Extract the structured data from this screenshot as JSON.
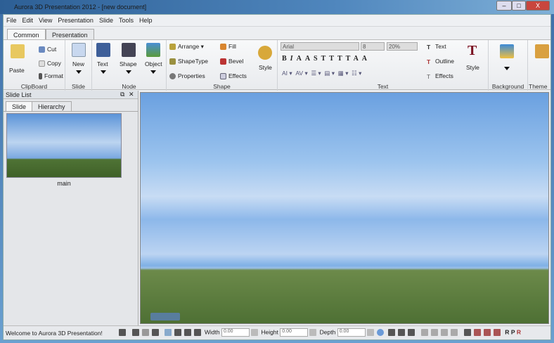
{
  "window": {
    "title": "Aurora 3D Presentation 2012 - [new document]",
    "min": "–",
    "max": "□",
    "close": "X"
  },
  "menu": [
    "File",
    "Edit",
    "View",
    "Presentation",
    "Slide",
    "Tools",
    "Help"
  ],
  "tabs": [
    "Common",
    "Presentation"
  ],
  "ribbon": {
    "clipboard": {
      "label": "ClipBoard",
      "paste": "Paste",
      "cut": "Cut",
      "copy": "Copy",
      "format": "Format"
    },
    "slide": {
      "label": "Slide",
      "new": "New"
    },
    "node": {
      "label": "Node",
      "text": "Text",
      "shape": "Shape",
      "object": "Object"
    },
    "shape": {
      "label": "Shape",
      "arrange": "Arrange",
      "shapetype": "ShapeType",
      "properties": "Properties",
      "fill": "Fill",
      "bevel": "Bevel",
      "effects": "Effects",
      "style": "Style"
    },
    "text": {
      "label": "Text",
      "font": "Arial",
      "size": "8",
      "percent": "20%",
      "fmt": [
        "B",
        "I",
        "A",
        "A",
        "S",
        "T",
        "T",
        "T",
        "T",
        "A",
        "A"
      ],
      "text": "Text",
      "outline": "Outline",
      "effects": "Effects",
      "style": "Style"
    },
    "background": {
      "label": "Background"
    },
    "theme": {
      "label": "Theme"
    }
  },
  "slide_list": {
    "title": "Slide List",
    "tabs": [
      "Slide",
      "Hierarchy"
    ],
    "slides": [
      {
        "name": "main"
      }
    ]
  },
  "status": {
    "message": "Welcome to Aurora 3D Presentation!",
    "width_label": "Width",
    "width": "0.00",
    "height_label": "Height",
    "height": "0.00",
    "depth_label": "Depth",
    "depth": "0.00",
    "r": [
      "R",
      "P",
      "R"
    ]
  }
}
